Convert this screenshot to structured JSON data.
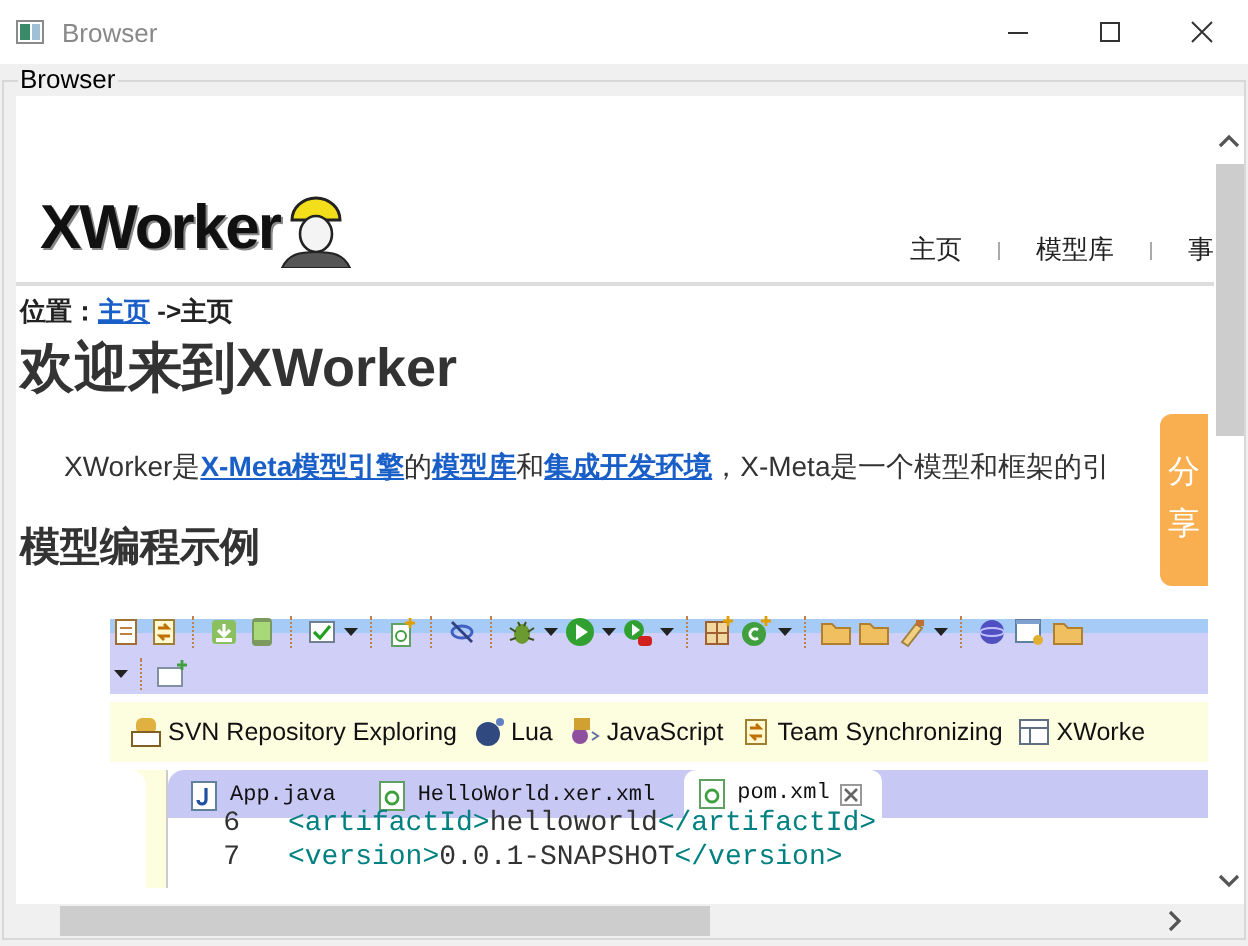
{
  "window": {
    "title": "Browser"
  },
  "group": {
    "label": "Browser"
  },
  "page": {
    "logo": "XWorker",
    "nav": [
      {
        "label": "主页"
      },
      {
        "label": "模型库"
      },
      {
        "label": "事"
      }
    ],
    "breadcrumb": {
      "prefix": "位置：",
      "link": "主页",
      "rest": "->主页"
    },
    "heading": "欢迎来到XWorker",
    "intro": [
      {
        "kind": "text",
        "text": "XWorker是"
      },
      {
        "kind": "link",
        "text": "X-Meta模型引擎"
      },
      {
        "kind": "text",
        "text": "的"
      },
      {
        "kind": "link",
        "text": "模型库"
      },
      {
        "kind": "text",
        "text": "和"
      },
      {
        "kind": "link",
        "text": "集成开发环境"
      },
      {
        "kind": "text",
        "text": "，X-Meta是一个模型和框架的引"
      }
    ],
    "share": "分享",
    "section_heading": "模型编程示例",
    "ide": {
      "toolbar": [
        {
          "kind": "doc"
        },
        {
          "kind": "sync"
        },
        {
          "kind": "sep"
        },
        {
          "kind": "download"
        },
        {
          "kind": "android"
        },
        {
          "kind": "sep"
        },
        {
          "kind": "check"
        },
        {
          "kind": "dropdown"
        },
        {
          "kind": "sep"
        },
        {
          "kind": "newfile"
        },
        {
          "kind": "sep"
        },
        {
          "kind": "linkoff"
        },
        {
          "kind": "sep"
        },
        {
          "kind": "bug"
        },
        {
          "kind": "dropdown"
        },
        {
          "kind": "run"
        },
        {
          "kind": "dropdown"
        },
        {
          "kind": "runstop"
        },
        {
          "kind": "dropdown"
        },
        {
          "kind": "sep"
        },
        {
          "kind": "grid"
        },
        {
          "kind": "newclass"
        },
        {
          "kind": "dropdown"
        },
        {
          "kind": "sep"
        },
        {
          "kind": "folder"
        },
        {
          "kind": "folder"
        },
        {
          "kind": "brush"
        },
        {
          "kind": "dropdown"
        },
        {
          "kind": "sep"
        },
        {
          "kind": "globe"
        },
        {
          "kind": "window"
        },
        {
          "kind": "folder"
        }
      ],
      "toolbar2": [
        {
          "kind": "dropdown"
        },
        {
          "kind": "sep"
        },
        {
          "kind": "newwindow"
        }
      ],
      "perspectives": [
        {
          "label": "SVN Repository Exploring",
          "kind": "svn"
        },
        {
          "label": "Lua",
          "kind": "ball"
        },
        {
          "label": "JavaScript",
          "kind": "js"
        },
        {
          "label": "Team Synchronizing",
          "kind": "sync"
        },
        {
          "label": "XWorke",
          "kind": "table"
        }
      ],
      "tabs": [
        {
          "label": "App.java",
          "kind": "java",
          "selected": false
        },
        {
          "label": "HelloWorld.xer.xml",
          "kind": "xml",
          "selected": false
        },
        {
          "label": "pom.xml",
          "kind": "xml",
          "selected": true
        }
      ],
      "code": [
        {
          "line": "6",
          "text": "<artifactId>helloworld</artifactId>"
        },
        {
          "line": "7",
          "text": "<version>0.0.1-SNAPSHOT</version>"
        }
      ]
    }
  }
}
